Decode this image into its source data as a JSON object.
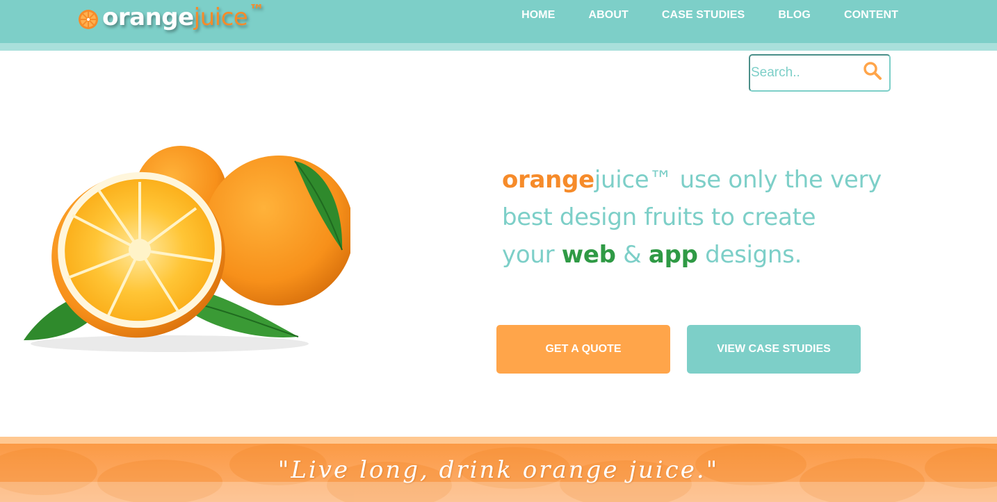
{
  "brand": {
    "name_part1": "orange",
    "name_part2": "juice",
    "trademark": "™"
  },
  "nav": {
    "items": [
      {
        "label": "HOME"
      },
      {
        "label": "ABOUT"
      },
      {
        "label": "CASE STUDIES"
      },
      {
        "label": "BLOG"
      },
      {
        "label": "CONTENT"
      }
    ]
  },
  "search": {
    "placeholder": "Search..",
    "icon": "search-icon"
  },
  "hero": {
    "tagline": {
      "brand_bold": "orange",
      "brand_rest": "juice™",
      "line1_rest": " use only the very",
      "line2": "best design fruits to create",
      "line3_start": "your ",
      "web": "web",
      "amp": " & ",
      "app": "app",
      "line3_end": " designs."
    },
    "buttons": {
      "quote": "GET A QUOTE",
      "case_studies": "VIEW CASE STUDIES"
    }
  },
  "footer_band": {
    "quote": "\"Live long, drink orange juice.\""
  },
  "colors": {
    "teal": "#7dcfc8",
    "orange": "#f68b2a",
    "button_orange": "#ffa54a",
    "green": "#2f9a45"
  }
}
